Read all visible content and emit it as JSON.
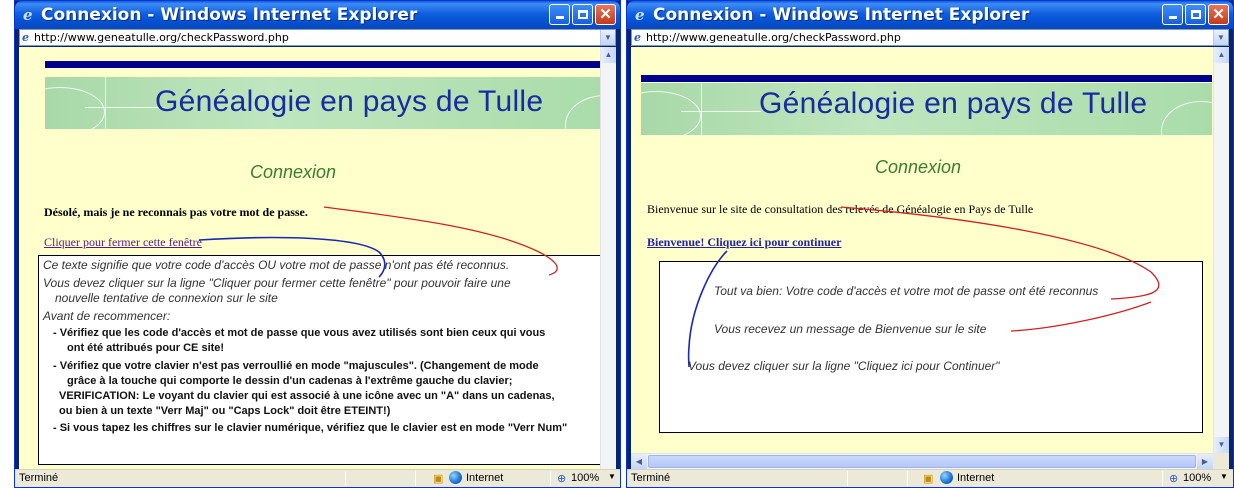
{
  "colors": {
    "title_bar": "#0553d4",
    "page_background": "#ffffcc",
    "banner_green": "#bfe6bf",
    "heading_blue": "#1a2aa0",
    "connexion_green": "#3a7d2a",
    "link_color": "#551a8b",
    "pen_red": "#cc2222",
    "pen_blue": "#1a2ab0"
  },
  "left_window": {
    "title": "Connexion - Windows Internet Explorer",
    "address": "http://www.geneatulle.org/checkPassword.php",
    "site_title": "Généalogie en pays de Tulle",
    "section_heading": "Connexion",
    "error_message": "Désolé, mais je ne reconnais pas votre mot de passe.",
    "close_link": "Cliquer pour fermer cette fenêtre",
    "help": {
      "line1": "Ce texte signifie que votre code d'accès OU votre mot de passe n'ont pas été reconnus.",
      "line2": "Vous devez cliquer sur la ligne \"Cliquer pour fermer cette fenêtre\"  pour pouvoir faire une",
      "line3": "nouvelle tentative de connexion sur le site",
      "line4": "Avant de recommencer:",
      "bullet1a": "- Vérifiez que les code d'accès et  mot de passe que vous avez utilisés sont bien ceux qui vous",
      "bullet1b": "ont été attribués  pour CE site!",
      "bullet2a": "- Vérifiez que votre clavier n'est pas verroullié en mode \"majuscules\". (Changement de mode",
      "bullet2b": "grâce à la touche qui comporte le dessin d'un cadenas à l'extrême gauche du clavier;",
      "bullet2c": "VERIFICATION: Le voyant du clavier qui est associé à une icône avec un \"A\" dans un cadenas,",
      "bullet2d": "ou bien à un texte \"Verr Maj\" ou \"Caps Lock\" doit être ETEINT!)",
      "bullet3a": "- Si vous tapez les chiffres sur le clavier numérique, vérifiez que le clavier est en mode \"Verr Num\""
    },
    "status": {
      "text": "Terminé",
      "zone": "Internet",
      "zoom": "100%"
    }
  },
  "right_window": {
    "title": "Connexion - Windows Internet Explorer",
    "address": "http://www.geneatulle.org/checkPassword.php",
    "site_title": "Généalogie en pays de Tulle",
    "section_heading": "Connexion",
    "welcome_message": "Bienvenue sur le site de consultation des relevés de Généalogie en Pays de Tulle",
    "continue_link": "Bienvenue! Cliquez ici pour continuer",
    "help": {
      "line1": "Tout va bien: Votre code d'accès et votre mot de passe ont été reconnus",
      "line2": "Vous recevez un message de Bienvenue sur le site",
      "line3": "Vous devez cliquer sur la ligne \"Cliquez ici pour Continuer\""
    },
    "status": {
      "text": "Terminé",
      "zone": "Internet",
      "zoom": "100%"
    }
  }
}
